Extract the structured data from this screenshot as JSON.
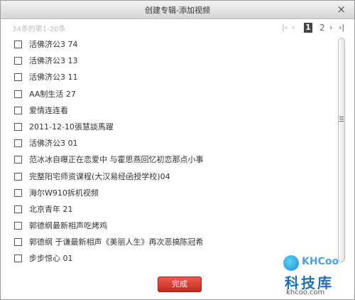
{
  "dialog": {
    "title": "创建专辑-添加视频",
    "close_glyph": "×"
  },
  "pagination": {
    "summary": "34条的第1-20条",
    "first": "|‹",
    "prev": "‹",
    "current": "1",
    "next_page": "2",
    "next": "›",
    "last": "›|"
  },
  "items": [
    {
      "label": "活佛济公3 74",
      "checked": false
    },
    {
      "label": "活佛济公3 13",
      "checked": false
    },
    {
      "label": "活佛济公3 11",
      "checked": false
    },
    {
      "label": "AA制生活 27",
      "checked": false
    },
    {
      "label": "爱情连连看",
      "checked": false
    },
    {
      "label": "2011-12-10張慧談馬躍",
      "checked": false
    },
    {
      "label": "活佛济公3 01",
      "checked": false
    },
    {
      "label": "范冰冰自曝正在恋爱中 与霍思燕回忆初恋那点小事",
      "checked": false
    },
    {
      "label": "完整阳宅师资课程(大汉易经函授学校)04",
      "checked": false
    },
    {
      "label": "海尔W910拆机视频",
      "checked": false
    },
    {
      "label": "北京青年 21",
      "checked": false
    },
    {
      "label": "郭德纲最新相声吃烤鸡",
      "checked": false
    },
    {
      "label": "郭德纲 于谦最新相声《美丽人生》再次恶搞陈冠希",
      "checked": false
    },
    {
      "label": "步步惊心 01",
      "checked": false
    }
  ],
  "footer": {
    "done_label": "完成"
  },
  "watermark": {
    "brand": "KHCoo",
    "cn": "科技库",
    "url": "khcoo.com"
  },
  "colors": {
    "done_button": "#d8362b",
    "current_page_bg": "#444444",
    "watermark_blue": "#1f6fb8"
  }
}
